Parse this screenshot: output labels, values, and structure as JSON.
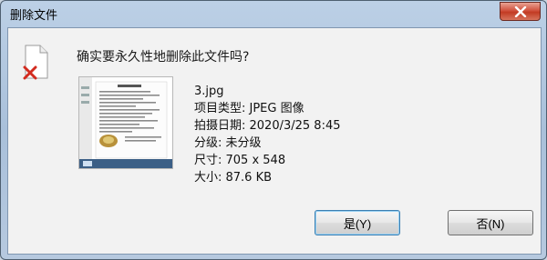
{
  "window": {
    "title": "删除文件"
  },
  "titlebar": {
    "close_icon": "close-icon"
  },
  "dialog": {
    "question": "确实要永久性地删除此文件吗?",
    "file_icon": "deleted-file-icon",
    "thumbnail_icon": "image-thumbnail",
    "file": {
      "name": "3.jpg",
      "type": "项目类型: JPEG 图像",
      "date": "拍摄日期: 2020/3/25 8:45",
      "rating": "分级: 未分级",
      "dimensions": "尺寸: 705 x 548",
      "size": "大小: 87.6 KB"
    }
  },
  "buttons": {
    "yes": "是(Y)",
    "no": "否(N)"
  }
}
